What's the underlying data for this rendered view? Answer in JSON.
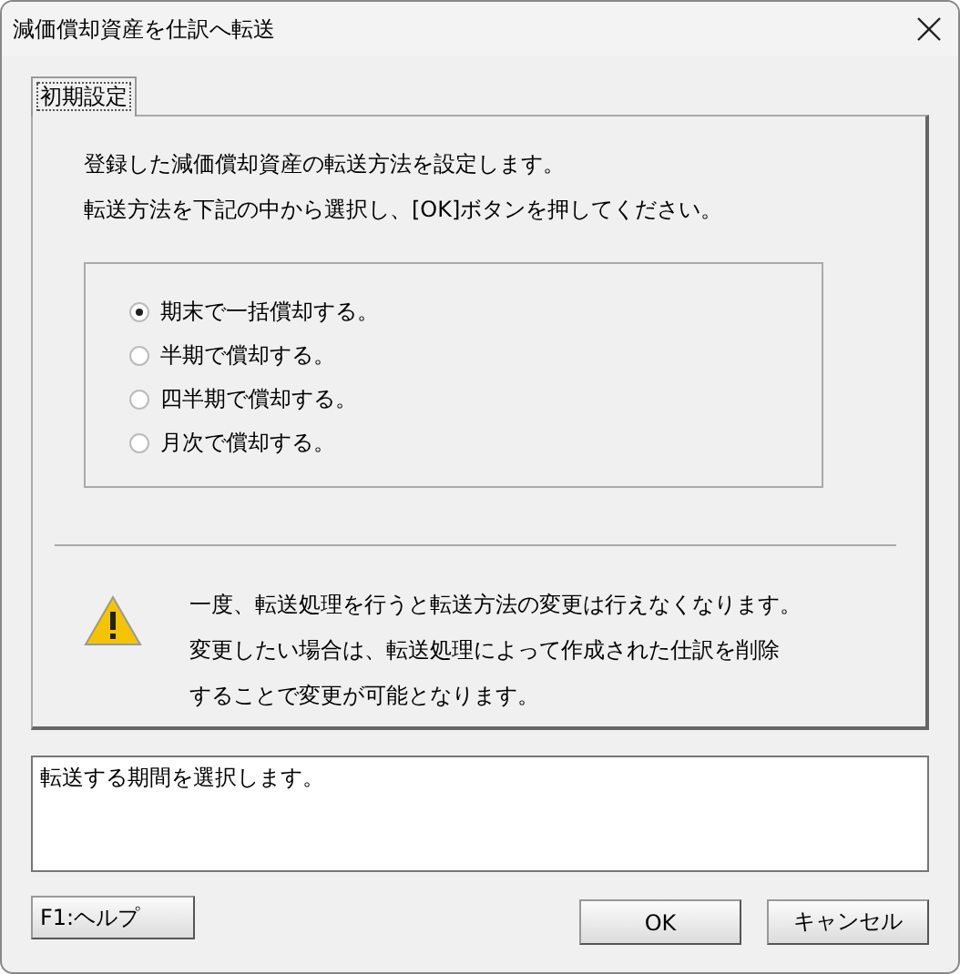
{
  "window": {
    "title": "減価償却資産を仕訳へ転送"
  },
  "tabs": [
    {
      "label": "初期設定",
      "selected": true
    }
  ],
  "intro": [
    "登録した減価償却資産の転送方法を設定します。",
    "転送方法を下記の中から選択し、[OK]ボタンを押してください。"
  ],
  "options": [
    {
      "label": "期末で一括償却する。",
      "selected": true
    },
    {
      "label": "半期で償却する。",
      "selected": false
    },
    {
      "label": "四半期で償却する。",
      "selected": false
    },
    {
      "label": "月次で償却する。",
      "selected": false
    }
  ],
  "warning": [
    "一度、転送処理を行うと転送方法の変更は行えなくなります。",
    "変更したい場合は、転送処理によって作成された仕訳を削除",
    "することで変更が可能となります。"
  ],
  "description": "転送する期間を選択します。",
  "buttons": {
    "help": "F1:ヘルプ",
    "ok": "OK",
    "cancel": "キャンセル"
  }
}
